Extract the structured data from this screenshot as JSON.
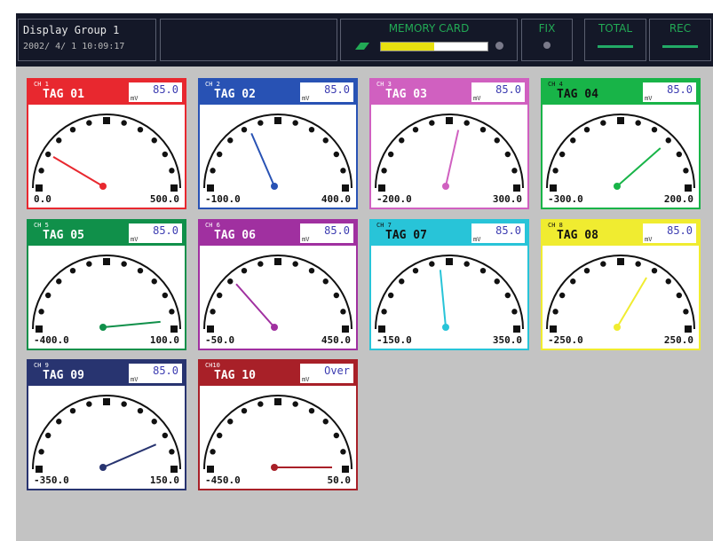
{
  "header": {
    "group_title": "Display Group 1",
    "datetime": "2002/ 4/ 1 10:09:17",
    "memory_card": {
      "label": "MEMORY CARD",
      "fill_fraction": 0.5
    },
    "fix_label": "FIX",
    "total_label": "TOTAL",
    "rec_label": "REC"
  },
  "colors": {
    "memory_fill": "#e8e010",
    "status_green": "#22aa55",
    "header_bg": "#141828"
  },
  "channels": [
    {
      "ch": "CH 1",
      "tag": "TAG 01",
      "value": "85.0",
      "unit": "mV",
      "min": "0.0",
      "max": "500.0",
      "needle": 0.17,
      "color": "#e8282f",
      "dark_text": false
    },
    {
      "ch": "CH 2",
      "tag": "TAG 02",
      "value": "85.0",
      "unit": "mV",
      "min": "-100.0",
      "max": "400.0",
      "needle": 0.37,
      "color": "#2852b4",
      "dark_text": false
    },
    {
      "ch": "CH 3",
      "tag": "TAG 03",
      "value": "85.0",
      "unit": "mV",
      "min": "-200.0",
      "max": "300.0",
      "needle": 0.57,
      "color": "#d060c0",
      "dark_text": false
    },
    {
      "ch": "CH 4",
      "tag": "TAG 04",
      "value": "85.0",
      "unit": "mV",
      "min": "-300.0",
      "max": "200.0",
      "needle": 0.77,
      "color": "#18b448",
      "dark_text": true
    },
    {
      "ch": "CH 5",
      "tag": "TAG 05",
      "value": "85.0",
      "unit": "mV",
      "min": "-400.0",
      "max": "100.0",
      "needle": 0.97,
      "color": "#10904a",
      "dark_text": false
    },
    {
      "ch": "CH 6",
      "tag": "TAG 06",
      "value": "85.0",
      "unit": "mV",
      "min": "-50.0",
      "max": "450.0",
      "needle": 0.27,
      "color": "#a030a0",
      "dark_text": false
    },
    {
      "ch": "CH 7",
      "tag": "TAG 07",
      "value": "85.0",
      "unit": "mV",
      "min": "-150.0",
      "max": "350.0",
      "needle": 0.47,
      "color": "#28c4d8",
      "dark_text": true
    },
    {
      "ch": "CH 8",
      "tag": "TAG 08",
      "value": "85.0",
      "unit": "mV",
      "min": "-250.0",
      "max": "250.0",
      "needle": 0.67,
      "color": "#f0ec30",
      "dark_text": true
    },
    {
      "ch": "CH 9",
      "tag": "TAG 09",
      "value": "85.0",
      "unit": "mV",
      "min": "-350.0",
      "max": "150.0",
      "needle": 0.87,
      "color": "#283470",
      "dark_text": false
    },
    {
      "ch": "CH10",
      "tag": "TAG 10",
      "value": "Over",
      "unit": "mV",
      "min": "-450.0",
      "max": "50.0",
      "needle": 1.0,
      "color": "#a82028",
      "dark_text": false
    }
  ]
}
